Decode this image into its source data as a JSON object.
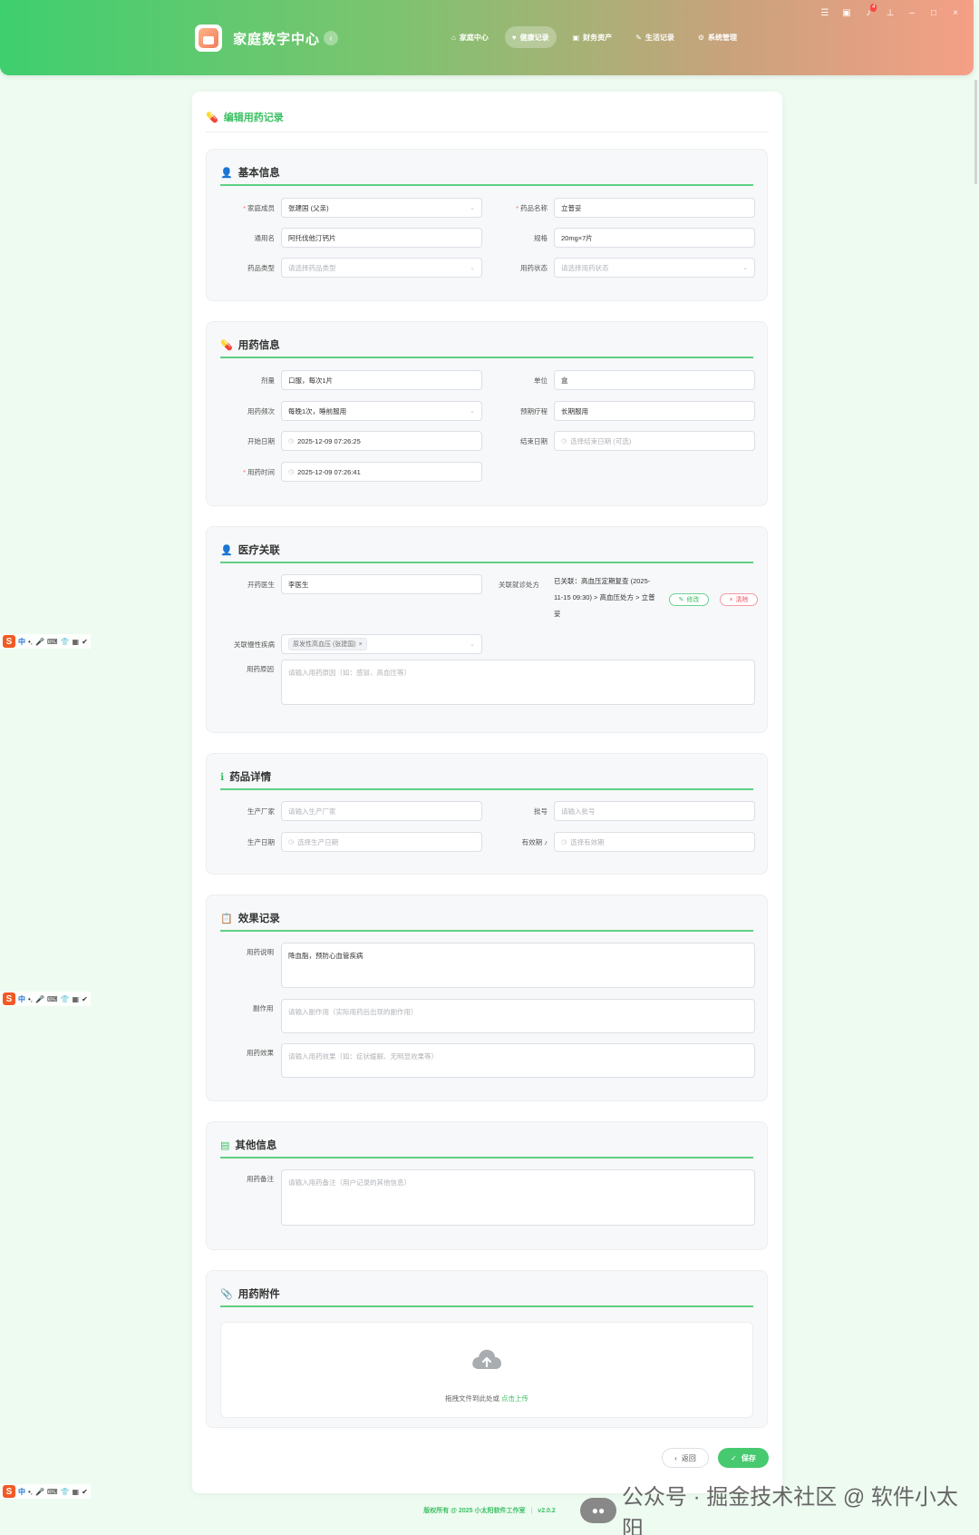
{
  "header": {
    "app_title": "家庭数字中心",
    "collapse_icon": "‹",
    "nav": [
      {
        "label": "家庭中心",
        "icon": "home-icon",
        "glyph": "⌂"
      },
      {
        "label": "健康记录",
        "icon": "heart-icon",
        "glyph": "♥"
      },
      {
        "label": "财务资产",
        "icon": "wallet-icon",
        "glyph": "▣"
      },
      {
        "label": "生活记录",
        "icon": "leaf-icon",
        "glyph": "✎"
      },
      {
        "label": "系统管理",
        "icon": "gears-icon",
        "glyph": "⚙"
      }
    ],
    "notification_count": "4",
    "colors": {
      "gradient_start": "#3ecf6f",
      "gradient_end": "#f59f86"
    }
  },
  "page": {
    "title": "编辑用药记录",
    "accent_color": "#3cc064"
  },
  "basic": {
    "title": "基本信息",
    "member_label": "家庭成员",
    "member_value": "张建国 (父亲)",
    "drug_name_label": "药品名称",
    "drug_name_value": "立普妥",
    "generic_label": "通用名",
    "generic_value": "阿托伐他汀钙片",
    "spec_label": "规格",
    "spec_value": "20mg×7片",
    "type_label": "药品类型",
    "type_placeholder": "请选择药品类型",
    "status_label": "用药状态",
    "status_placeholder": "请选择用药状态"
  },
  "usage": {
    "title": "用药信息",
    "dosage_label": "剂量",
    "dosage_value": "口服，每次1片",
    "unit_label": "单位",
    "unit_value": "盒",
    "freq_label": "用药频次",
    "freq_value": "每晚1次，睡前服用",
    "course_label": "预期疗程",
    "course_value": "长期服用",
    "start_label": "开始日期",
    "start_value": "2025-12-09 07:26:25",
    "end_label": "结束日期",
    "end_placeholder": "选择结束日期 (可选)",
    "time_label": "用药时间",
    "time_value": "2025-12-09 07:26:41"
  },
  "medical": {
    "title": "医疗关联",
    "doctor_label": "开药医生",
    "doctor_value": "李医生",
    "visit_label": "关联就诊处方",
    "visit_line1": "已关联：高血压定期复查 (2025-",
    "visit_line2": "11-15 09:30) > 高血压处方 > 立普",
    "visit_line3": "妥",
    "edit_label": "修改",
    "clear_label": "清除",
    "chronic_label": "关联慢性疾病",
    "chronic_tag": "原发性高血压 (张建国)",
    "reason_label": "用药原因",
    "reason_placeholder": "请输入用药原因（如：感冒、高血压等）"
  },
  "details": {
    "title": "药品详情",
    "maker_label": "生产厂家",
    "maker_placeholder": "请输入生产厂家",
    "batch_label": "批号",
    "batch_placeholder": "请输入批号",
    "mfg_label": "生产日期",
    "mfg_placeholder": "选择生产日期",
    "exp_label": "有效期",
    "exp_placeholder": "选择有效期"
  },
  "effect": {
    "title": "效果记录",
    "desc_label": "用药说明",
    "desc_value": "降血脂，预防心血管疾病",
    "side_label": "副作用",
    "side_placeholder": "请输入副作用（实际用药后出现的副作用）",
    "result_label": "用药效果",
    "result_placeholder": "请输入用药效果（如：症状缓解、无明显效果等）"
  },
  "other": {
    "title": "其他信息",
    "note_label": "用药备注",
    "note_placeholder": "请输入用药备注（用户记录的其他信息）"
  },
  "attach": {
    "title": "用药附件",
    "upload_text": "拖拽文件到此处或 ",
    "upload_link": "点击上传"
  },
  "actions": {
    "back_label": "返回",
    "save_label": "保存"
  },
  "footer": {
    "copyright": "版权所有 @ 2025 小太阳软件工作室",
    "version": "v2.0.2"
  },
  "ime": {
    "s_glyph": "S",
    "lang": "中"
  },
  "watermark": {
    "text": "公众号 · 掘金技术社区 @ 软件小太阳"
  }
}
